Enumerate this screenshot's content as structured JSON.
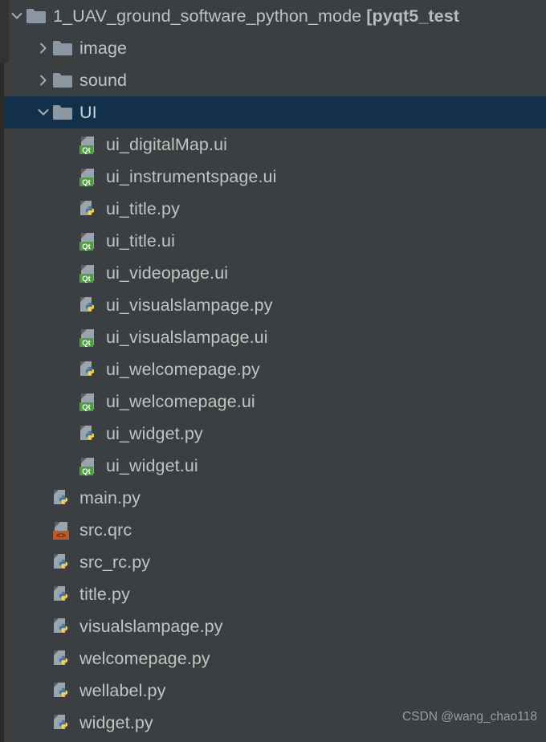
{
  "theme": {
    "background": "#3c3f41",
    "selection_background": "#123049",
    "text_color": "#c2c4c4",
    "folder_icon_color": "#8b97a2",
    "qt_badge_color": "#4c9e3f",
    "qrc_badge_color": "#c0562a",
    "python_blue": "#3c76ad",
    "python_yellow": "#ffd241",
    "gutter_color": "#2b2b2b"
  },
  "tree": {
    "rows": [
      {
        "label": "1_UAV_ground_software_python_mode ",
        "module": "[pyqt5_test",
        "icon": "folder-icon",
        "chevron": "chevron-down-icon",
        "indent": 0,
        "selected": false,
        "kind": "root-folder"
      },
      {
        "label": "image",
        "icon": "folder-icon",
        "chevron": "chevron-right-icon",
        "indent": 1,
        "selected": false,
        "kind": "folder"
      },
      {
        "label": "sound",
        "icon": "folder-icon",
        "chevron": "chevron-right-icon",
        "indent": 1,
        "selected": false,
        "kind": "folder"
      },
      {
        "label": "UI",
        "icon": "folder-icon",
        "chevron": "chevron-down-icon",
        "indent": 1,
        "selected": true,
        "kind": "folder"
      },
      {
        "label": "ui_digitalMap.ui",
        "icon": "qt-ui-file-icon",
        "chevron": "",
        "indent": 2,
        "selected": false,
        "kind": "file"
      },
      {
        "label": "ui_instrumentspage.ui",
        "icon": "qt-ui-file-icon",
        "chevron": "",
        "indent": 2,
        "selected": false,
        "kind": "file"
      },
      {
        "label": "ui_title.py",
        "icon": "python-file-icon",
        "chevron": "",
        "indent": 2,
        "selected": false,
        "kind": "file"
      },
      {
        "label": "ui_title.ui",
        "icon": "qt-ui-file-icon",
        "chevron": "",
        "indent": 2,
        "selected": false,
        "kind": "file"
      },
      {
        "label": "ui_videopage.ui",
        "icon": "qt-ui-file-icon",
        "chevron": "",
        "indent": 2,
        "selected": false,
        "kind": "file"
      },
      {
        "label": "ui_visualslampage.py",
        "icon": "python-file-icon",
        "chevron": "",
        "indent": 2,
        "selected": false,
        "kind": "file"
      },
      {
        "label": "ui_visualslampage.ui",
        "icon": "qt-ui-file-icon",
        "chevron": "",
        "indent": 2,
        "selected": false,
        "kind": "file"
      },
      {
        "label": "ui_welcomepage.py",
        "icon": "python-file-icon",
        "chevron": "",
        "indent": 2,
        "selected": false,
        "kind": "file"
      },
      {
        "label": "ui_welcomepage.ui",
        "icon": "qt-ui-file-icon",
        "chevron": "",
        "indent": 2,
        "selected": false,
        "kind": "file"
      },
      {
        "label": "ui_widget.py",
        "icon": "python-file-icon",
        "chevron": "",
        "indent": 2,
        "selected": false,
        "kind": "file"
      },
      {
        "label": "ui_widget.ui",
        "icon": "qt-ui-file-icon",
        "chevron": "",
        "indent": 2,
        "selected": false,
        "kind": "file"
      },
      {
        "label": "main.py",
        "icon": "python-file-icon",
        "chevron": "",
        "indent": 1,
        "selected": false,
        "kind": "file"
      },
      {
        "label": "src.qrc",
        "icon": "qrc-file-icon",
        "chevron": "",
        "indent": 1,
        "selected": false,
        "kind": "file"
      },
      {
        "label": "src_rc.py",
        "icon": "python-file-icon",
        "chevron": "",
        "indent": 1,
        "selected": false,
        "kind": "file"
      },
      {
        "label": "title.py",
        "icon": "python-file-icon",
        "chevron": "",
        "indent": 1,
        "selected": false,
        "kind": "file"
      },
      {
        "label": "visualslampage.py",
        "icon": "python-file-icon",
        "chevron": "",
        "indent": 1,
        "selected": false,
        "kind": "file"
      },
      {
        "label": "welcomepage.py",
        "icon": "python-file-icon",
        "chevron": "",
        "indent": 1,
        "selected": false,
        "kind": "file"
      },
      {
        "label": "wellabel.py",
        "icon": "python-file-icon",
        "chevron": "",
        "indent": 1,
        "selected": false,
        "kind": "file"
      },
      {
        "label": "widget.py",
        "icon": "python-file-icon",
        "chevron": "",
        "indent": 1,
        "selected": false,
        "kind": "file"
      }
    ]
  },
  "watermark": {
    "text": "CSDN @wang_chao118"
  }
}
